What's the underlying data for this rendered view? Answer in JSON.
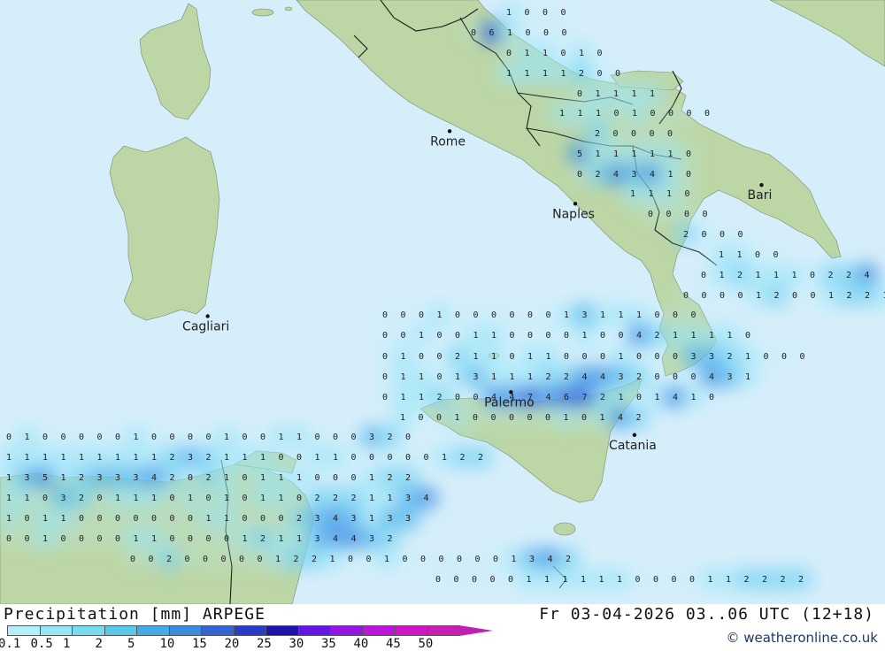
{
  "title": "Precipitation [mm] ARPEGE",
  "timestamp": "Fr 03-04-2026 03..06 UTC (12+18)",
  "credit": "© weatheronline.co.uk",
  "colors": {
    "sea": "#d6eefa",
    "land": "#bcd6a6",
    "border": "#1a1a1a"
  },
  "cities": [
    {
      "name": "Rome",
      "lon": 12.5,
      "lat": 41.9
    },
    {
      "name": "Naples",
      "lon": 14.26,
      "lat": 40.85
    },
    {
      "name": "Bari",
      "lon": 16.87,
      "lat": 41.12
    },
    {
      "name": "Cagliari",
      "lon": 9.11,
      "lat": 39.22
    },
    {
      "name": "Palermo",
      "lon": 13.36,
      "lat": 38.12
    },
    {
      "name": "Catania",
      "lon": 15.09,
      "lat": 37.5
    }
  ],
  "precip_grid": [
    {
      "row": 0,
      "text": "1 0 0 0"
    },
    {
      "row": 1,
      "text": "0 6 1 0 0 0"
    },
    {
      "row": 2,
      "text": "0 1 1 0 1 0"
    },
    {
      "row": 3,
      "text": "1 1 1 1 2 0 0"
    },
    {
      "row": 4,
      "text": "0 1 1 1 1"
    },
    {
      "row": 5,
      "text": "1 1 1 0 1 0 0 0 0"
    },
    {
      "row": 6,
      "text": "2 0 0 0 0"
    },
    {
      "row": 7,
      "text": "5 1 1 1 1 1 0"
    },
    {
      "row": 8,
      "text": "0 2 4 3 4 1 0"
    },
    {
      "row": 9,
      "text": "1 1 1 0"
    },
    {
      "row": 10,
      "text": "0 0 0 0"
    },
    {
      "row": 11,
      "text": "2 0 0 0"
    },
    {
      "row": 12,
      "text": "1 1 0 0"
    },
    {
      "row": 13,
      "text": "0 1 2 1 1 1 0 2 2 4"
    },
    {
      "row": 14,
      "text": "0 0 0 0 1 2 0 0 1 2 2 1"
    },
    {
      "row": 15,
      "text": "0 0 0 1 0 0 0 0 0 0 1 3 1 1 1 0 0 0"
    },
    {
      "row": 16,
      "text": "0 0 1 0 0 1 1 0 0 0 0 1 0 0 4 2 1 1 1 1 0"
    },
    {
      "row": 17,
      "text": "0 1 0 0 2 1 1 0 1 1 0 0 0 1 0 0 0 3 3 2 1 0 0 0"
    },
    {
      "row": 18,
      "text": "0 1 1 0 1 3 1 1 1 2 2 4 4 3 2 0 0 0 4 3 1"
    },
    {
      "row": 19,
      "text": "0 1 1 2 0 0 4 4 7 4 6 7 2 1 0 1 4 1 0"
    },
    {
      "row": 20,
      "text": "1 0 0 1 0 0 0 0 0 1 0 1 4 2"
    },
    {
      "row": 21,
      "text": "0 1 0 0 0 0 0 1 0 0 0 0 1 0 0 1 1 0 0 0 3 2 0"
    },
    {
      "row": 22,
      "text": "1 1 1 1 1 1 1 1 1 2 3 2 1 1 1 0 0 1 1 0 0 0 0 0 1 2 2"
    },
    {
      "row": 23,
      "text": "1 3 5 1 2 3 3 3 4 2 0 2 1 0 1 1 1 0 0 0 1 2 2"
    },
    {
      "row": 24,
      "text": "1 1 0 3 2 0 1 1 1 0 1 0 1 0 1 1 0 2 2 2 1 1 3 4"
    },
    {
      "row": 25,
      "text": "1 0 1 1 0 0 0 0 0 0 0 1 1 0 0 0 2 3 4 3 1 3 3"
    },
    {
      "row": 26,
      "text": "0 0 1 0 0 0 0 1 1 0 0 0 0 1 2 1 1 3 4 4 3 2"
    },
    {
      "row": 27,
      "text": "0 0 2 0 0 0 0 0 1 2 2 1 0 0 1 0 0 0 0 0 0 1 3 4 2"
    },
    {
      "row": 28,
      "text": "0 0 0 0 0 1 1 1 1 1 1 0 0 0 0 1 1 2 2 2 2"
    }
  ],
  "legend": {
    "labels": [
      "0.1",
      "0.5",
      "1",
      "2",
      "5",
      "10",
      "15",
      "20",
      "25",
      "30",
      "35",
      "40",
      "45",
      "50"
    ],
    "colors": [
      "#b4f0fa",
      "#96e6f5",
      "#78dcf0",
      "#5ac8eb",
      "#46aae6",
      "#3c8cdc",
      "#3264d2",
      "#283cc8",
      "#1e14aa",
      "#6414e6",
      "#9614e6",
      "#be14dc",
      "#d214c8",
      "#c81eb4"
    ]
  }
}
